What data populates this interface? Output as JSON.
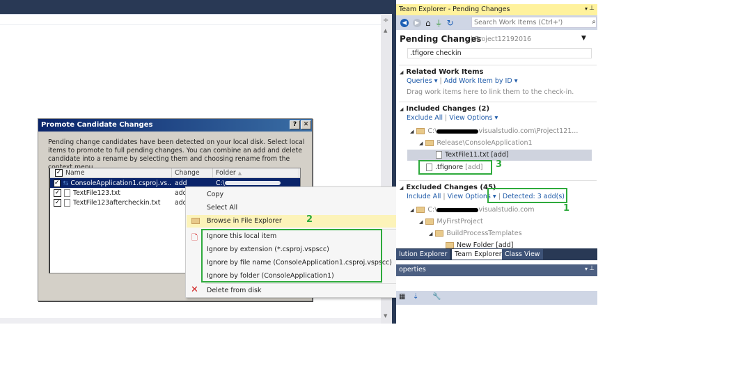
{
  "dialog": {
    "title": "Promote Candidate Changes",
    "help_label": "?",
    "close_label": "✕",
    "description": "Pending change candidates have been detected on your local disk. Select local items to promote to full pending changes. You can combine an add and delete candidate into a rename by selecting them and choosing rename from the context menu.",
    "columns": [
      "Name",
      "Change",
      "Folder"
    ],
    "rows": [
      {
        "name": "ConsoleApplication1.csproj.vs...",
        "change": "add",
        "folder": "C:\\",
        "selected": true,
        "checked": true
      },
      {
        "name": "TextFile123.txt",
        "change": "add",
        "folder": "",
        "selected": false,
        "checked": true
      },
      {
        "name": "TextFile123aftercheckin.txt",
        "change": "add",
        "folder": "",
        "selected": false,
        "checked": true
      }
    ]
  },
  "context_menu": {
    "items": [
      "Copy",
      "Select All",
      "Browse in File Explorer",
      "Ignore this local item",
      "Ignore by extension (*.csproj.vspscc)",
      "Ignore by file name (ConsoleApplication1.csproj.vspscc)",
      "Ignore by folder (ConsoleApplication1)",
      "Delete from disk"
    ],
    "highlighted": "Browse in File Explorer"
  },
  "annotations": {
    "one": "1",
    "two": "2",
    "three": "3",
    "color": "#2eaa3c"
  },
  "team_explorer": {
    "title": "Team Explorer - Pending Changes",
    "search_placeholder": "Search Work Items (Ctrl+')",
    "header": "Pending Changes",
    "project": "Project12192016",
    "comment": ".tfigore checkin",
    "related": {
      "title": "Related Work Items",
      "queries": "Queries",
      "add_by_id": "Add Work Item by ID",
      "hint": "Drag work items here to link them to the check-in."
    },
    "included": {
      "title": "Included Changes (2)",
      "exclude_all": "Exclude All",
      "view_options": "View Options",
      "tree": [
        "C:\\",
        "visualstudio.com\\Project121...",
        "Release\\ConsoleApplication1",
        "TextFile11.txt [add]",
        ".tfignore",
        "[add]"
      ]
    },
    "excluded": {
      "title": "Excluded Changes (45)",
      "include_all": "Include All",
      "view_options": "View Options",
      "detected": "Detected: 3 add(s)",
      "tree": [
        "C:\\",
        "visualstudio.com",
        "MyFirstProject",
        "BuildProcessTemplates",
        "New Folder [add]"
      ]
    },
    "tabs": [
      "lution Explorer",
      "Team Explorer",
      "Class View"
    ],
    "active_tab": "Team Explorer",
    "properties": "operties"
  }
}
